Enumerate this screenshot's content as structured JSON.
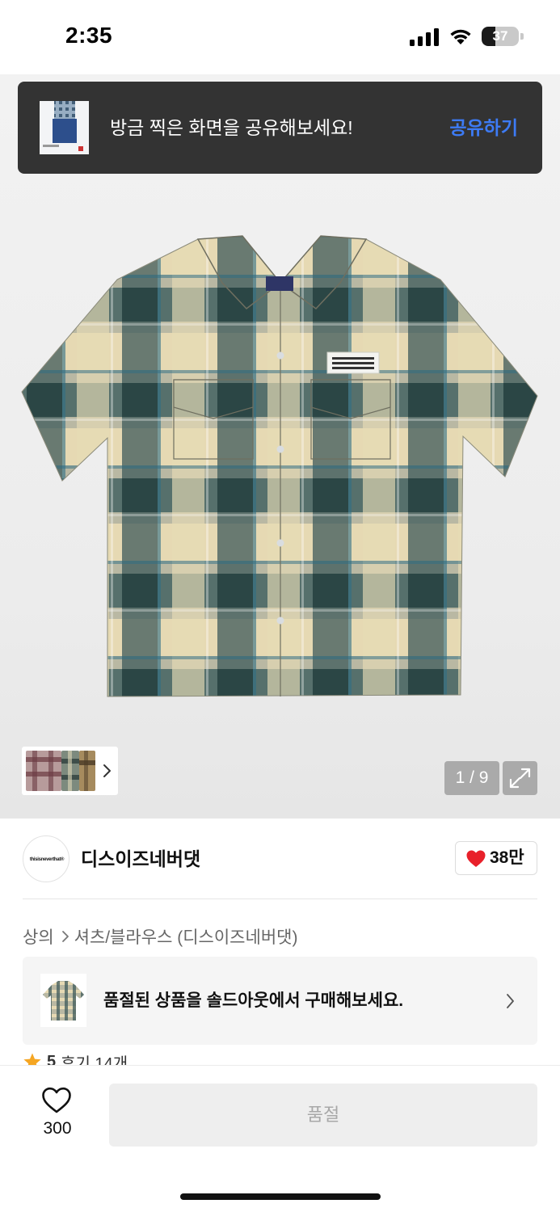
{
  "status_bar": {
    "time": "2:35",
    "battery_level": "37",
    "battery_fraction": 0.37,
    "icons": [
      "signal-icon",
      "wifi-icon",
      "battery-icon"
    ]
  },
  "share_toast": {
    "message": "방금 찍은 화면을 공유해보세요!",
    "action_label": "공유하기",
    "action_color": "#3d7bf5"
  },
  "gallery": {
    "counter": "1 / 9",
    "thumbnails_icon": "chevron-right-icon",
    "expand_icon": "expand-icon"
  },
  "brand": {
    "logo_text": "thisisneverthat®",
    "name": "디스이즈네버댓",
    "like_count": "38만",
    "heart_color": "#e8202a"
  },
  "breadcrumb": {
    "category": "상의",
    "subcategory": "셔츠/블라우스 (디스이즈네버댓)"
  },
  "soldout_banner": {
    "message": "품절된 상품을 솔드아웃에서 구매해보세요."
  },
  "review": {
    "rating": "5",
    "count_label": "후기 14개"
  },
  "bottom_bar": {
    "wish_count": "300",
    "buy_label": "품절"
  }
}
